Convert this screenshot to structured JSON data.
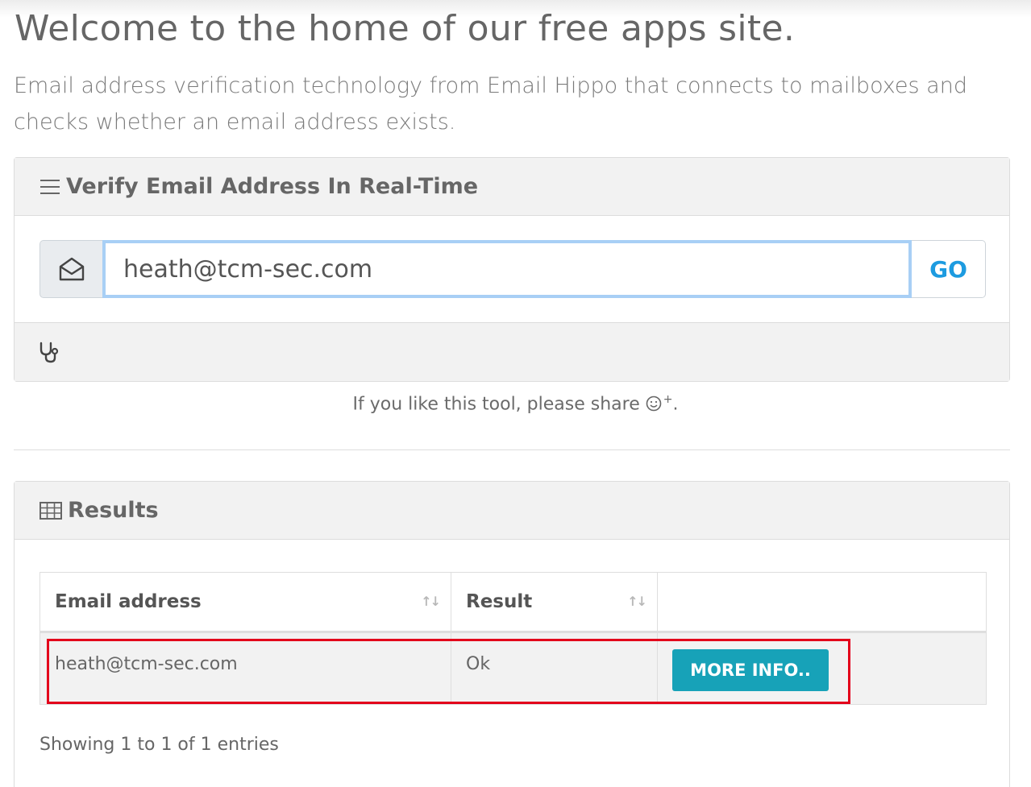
{
  "header": {
    "title": "Welcome to the home of our free apps site.",
    "subtitle": "Email address verification technology from Email Hippo that connects to mailboxes and checks whether an email address exists."
  },
  "verify_card": {
    "title": "Verify Email Address In Real-Time",
    "icon": "hamburger-icon",
    "input_icon": "envelope-open-icon",
    "email_value": "heath@tcm-sec.com",
    "go_label": "GO",
    "footer_icon": "stethoscope-icon"
  },
  "share": {
    "text": "If you like this tool, please share",
    "icon": "smiley-plus-icon",
    "suffix": "."
  },
  "results_card": {
    "title": "Results",
    "icon": "table-icon",
    "columns": [
      "Email address",
      "Result",
      ""
    ],
    "rows": [
      {
        "email": "heath@tcm-sec.com",
        "result": "Ok",
        "action_label": "MORE INFO.."
      }
    ],
    "entries_text": "Showing 1 to 1 of 1 entries"
  },
  "colors": {
    "accent_blue": "#1d9be0",
    "button_teal": "#17a2b8",
    "highlight_red": "#e3001b",
    "input_focus": "#a8cff5"
  }
}
